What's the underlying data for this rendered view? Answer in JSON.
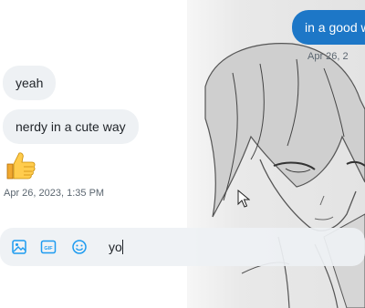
{
  "messages": {
    "outgoing_partial": "in a good w",
    "outgoing_timestamp_partial": "Apr 26, 2",
    "incoming": [
      "yeah",
      "nerdy in a cute way"
    ],
    "incoming_reaction_icon": "thumbs-up-emoji",
    "incoming_timestamp": "Apr 26, 2023, 1:35 PM"
  },
  "composer": {
    "tools": [
      "image-icon",
      "gif-icon",
      "emoji-icon"
    ],
    "gif_label": "GIF",
    "value": "yo"
  },
  "colors": {
    "outgoing_bubble": "#1d77c7",
    "incoming_bubble": "#eef1f4",
    "accent": "#1d9bf0"
  }
}
